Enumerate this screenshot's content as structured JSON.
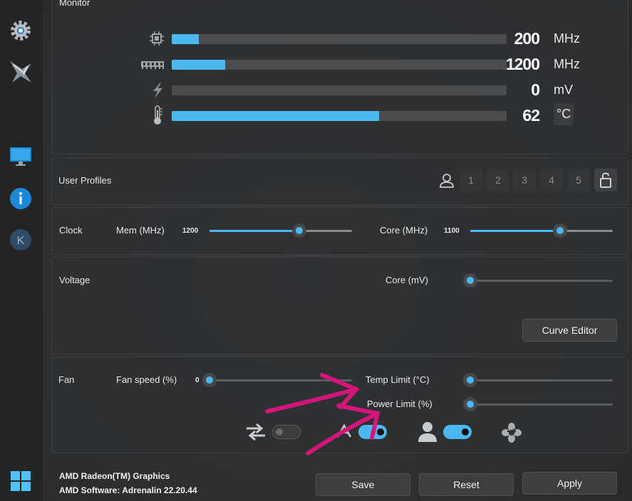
{
  "monitor": {
    "title": "Monitor",
    "rows": [
      {
        "icon": "cpu-chip-icon",
        "value": "200",
        "unit": "MHz",
        "level": 0.08
      },
      {
        "icon": "memory-module-icon",
        "value": "1200",
        "unit": "MHz",
        "level": 0.16
      },
      {
        "icon": "lightning-bolt-icon",
        "value": "0",
        "unit": "mV",
        "level": 0.0
      },
      {
        "icon": "thermometer-icon",
        "value": "62",
        "unit": "°C",
        "level": 0.62
      }
    ]
  },
  "profiles": {
    "label": "User Profiles",
    "slots": [
      "1",
      "2",
      "3",
      "4",
      "5"
    ]
  },
  "clock": {
    "label": "Clock",
    "mem_label": "Mem (MHz)",
    "mem_value": "1200",
    "mem_level": 0.63,
    "core_label": "Core (MHz)",
    "core_value": "1100",
    "core_level": 0.63
  },
  "voltage": {
    "label": "Voltage",
    "core_label": "Core (mV)",
    "core_level": 0.0,
    "curve_editor": "Curve Editor"
  },
  "fan": {
    "label": "Fan",
    "speed_label": "Fan speed (%)",
    "speed_value": "0",
    "speed_level": 0.0,
    "temp_limit_label": "Temp Limit (°C)",
    "temp_limit_level": 0.0,
    "power_limit_label": "Power Limit (%)",
    "power_limit_level": 0.0,
    "toggles": {
      "sync": false,
      "auto": true,
      "user": true
    }
  },
  "footer": {
    "gpu_name": "AMD Radeon(TM) Graphics",
    "driver": "AMD Software: Adrenalin 22.20.44",
    "save": "Save",
    "reset": "Reset",
    "apply": "Apply"
  },
  "colors": {
    "accent": "#4cb8f0",
    "annotation_arrow": "#d4157a"
  }
}
